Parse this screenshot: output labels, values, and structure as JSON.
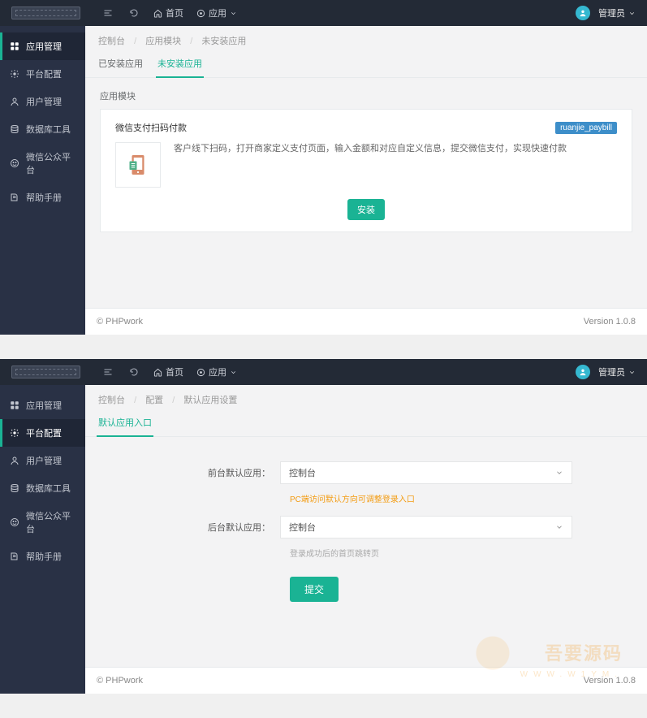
{
  "panel1": {
    "topbar": {
      "home_label": "首页",
      "app_label": "应用",
      "user_label": "管理员"
    },
    "sidebar": {
      "items": [
        {
          "label": "应用管理",
          "active": true
        },
        {
          "label": "平台配置",
          "active": false
        },
        {
          "label": "用户管理",
          "active": false
        },
        {
          "label": "数据库工具",
          "active": false
        },
        {
          "label": "微信公众平台",
          "active": false
        },
        {
          "label": "帮助手册",
          "active": false
        }
      ]
    },
    "breadcrumb": [
      "控制台",
      "应用模块",
      "未安装应用"
    ],
    "tabs": [
      {
        "label": "已安装应用",
        "active": false
      },
      {
        "label": "未安装应用",
        "active": true
      }
    ],
    "section_label": "应用模块",
    "card": {
      "title": "微信支付扫码付款",
      "badge": "ruanjie_paybill",
      "description": "客户线下扫码，打开商家定义支付页面，输入金额和对应自定义信息，提交微信支付，实现快速付款",
      "install_label": "安装"
    },
    "footer": {
      "left": "© PHPwork",
      "right": "Version 1.0.8"
    }
  },
  "panel2": {
    "topbar": {
      "home_label": "首页",
      "app_label": "应用",
      "user_label": "管理员"
    },
    "sidebar": {
      "items": [
        {
          "label": "应用管理",
          "active": false
        },
        {
          "label": "平台配置",
          "active": true
        },
        {
          "label": "用户管理",
          "active": false
        },
        {
          "label": "数据库工具",
          "active": false
        },
        {
          "label": "微信公众平台",
          "active": false
        },
        {
          "label": "帮助手册",
          "active": false
        }
      ]
    },
    "breadcrumb": [
      "控制台",
      "配置",
      "默认应用设置"
    ],
    "tabs": [
      {
        "label": "默认应用入口",
        "active": true
      }
    ],
    "form": {
      "front_label": "前台默认应用：",
      "front_value": "控制台",
      "front_hint": "PC端访问默认方向可调整登录入口",
      "back_label": "后台默认应用：",
      "back_value": "控制台",
      "back_hint": "登录成功后的首页跳转页",
      "submit_label": "提交"
    },
    "footer": {
      "left": "© PHPwork",
      "right": "Version 1.0.8"
    },
    "watermark": {
      "text": "吾要源码",
      "sub": "WWW.W1YM."
    }
  }
}
